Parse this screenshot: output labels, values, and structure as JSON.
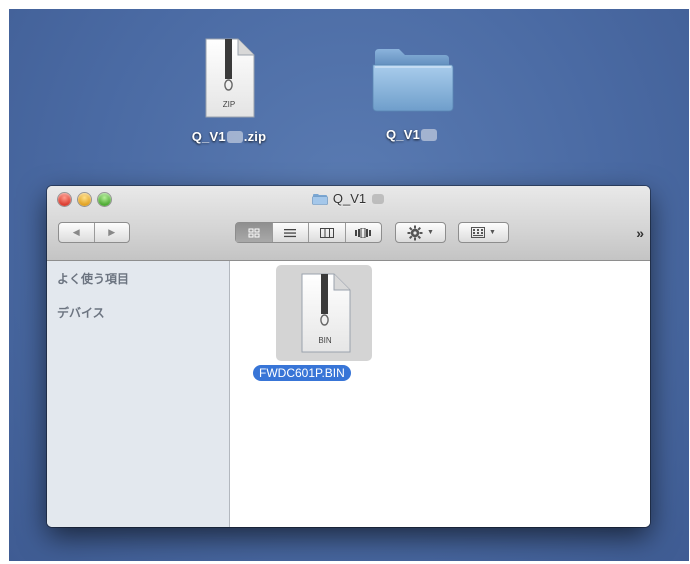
{
  "desktop": {
    "zip_file": {
      "label_prefix": "Q_V1",
      "label_suffix": ".zip",
      "icon_badge": "ZIP",
      "icon": "zip-archive-icon"
    },
    "folder": {
      "label_prefix": "Q_V1",
      "icon": "folder-icon"
    }
  },
  "window": {
    "title": "Q_V1",
    "toolbar": {
      "back_glyph": "◀",
      "forward_glyph": "▶",
      "view_modes": [
        "icon-view",
        "list-view",
        "column-view",
        "coverflow-view"
      ],
      "active_view": "icon-view",
      "overflow_glyph": "»"
    },
    "sidebar": {
      "sections": [
        "よく使う項目",
        "デバイス"
      ]
    },
    "content": {
      "files": [
        {
          "name": "FWDC601P.BIN",
          "icon_badge": "BIN",
          "selected": true
        }
      ]
    }
  },
  "colors": {
    "desktop": "#4a6aa3",
    "selection": "#3875d7",
    "sidebar": "#e3e8ee"
  }
}
